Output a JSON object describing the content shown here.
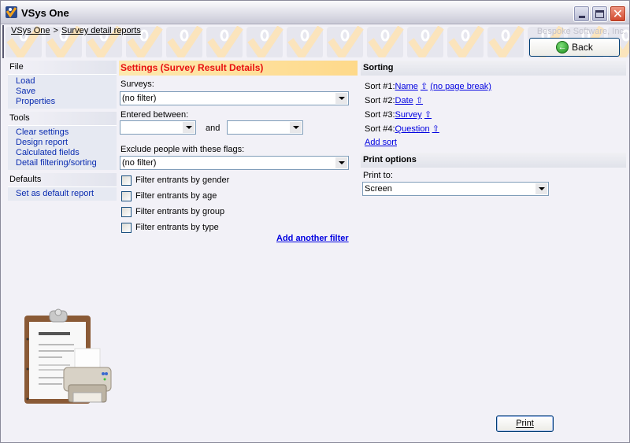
{
  "window": {
    "title": "VSys One",
    "controls": {
      "minimize": "minimize",
      "maximize": "maximize",
      "close": "close"
    }
  },
  "breadcrumb": {
    "items": [
      "VSys One",
      "Survey detail reports"
    ],
    "separator": ">"
  },
  "company": "Bespoke Software, Inc.",
  "back_button": {
    "label": "Back",
    "icon": "arrow-left-circle-icon"
  },
  "sidebar": {
    "groups": [
      {
        "title": "File",
        "items": [
          "Load",
          "Save",
          "Properties"
        ]
      },
      {
        "title": "Tools",
        "items": [
          "Clear settings",
          "Design report",
          "Calculated fields",
          "Detail filtering/sorting"
        ]
      },
      {
        "title": "Defaults",
        "items": [
          "Set as default report"
        ]
      }
    ]
  },
  "settings": {
    "title": "Settings (Survey Result Details)",
    "surveys_label": "Surveys:",
    "surveys_value": "(no filter)",
    "entered_between_label": "Entered between:",
    "date_from_value": "",
    "and_label": "and",
    "date_to_value": "",
    "exclude_flags_label": "Exclude people with these flags:",
    "exclude_flags_value": "(no filter)",
    "checkboxes": [
      {
        "label": "Filter entrants by gender",
        "checked": false
      },
      {
        "label": "Filter entrants by age",
        "checked": false
      },
      {
        "label": "Filter entrants by group",
        "checked": false
      },
      {
        "label": "Filter entrants by type",
        "checked": false
      }
    ],
    "add_filter_link": "Add another filter"
  },
  "sorting": {
    "title": "Sorting",
    "sorts": [
      {
        "prefix": "Sort #1:",
        "field": "Name",
        "arrow": "⇧",
        "extra": "(no page break)"
      },
      {
        "prefix": "Sort #2:",
        "field": "Date",
        "arrow": "⇧"
      },
      {
        "prefix": "Sort #3:",
        "field": "Survey",
        "arrow": "⇧"
      },
      {
        "prefix": "Sort #4:",
        "field": "Question",
        "arrow": "⇧"
      }
    ],
    "add_sort_link": "Add sort"
  },
  "print_options": {
    "title": "Print options",
    "print_to_label": "Print to:",
    "print_to_value": "Screen"
  },
  "print_button": {
    "label": "Print"
  },
  "colors": {
    "link_blue": "#0000e0",
    "sidebar_link": "#0a2cb0",
    "settings_title": "#e81010",
    "settings_header_bg": "#fed98a"
  }
}
